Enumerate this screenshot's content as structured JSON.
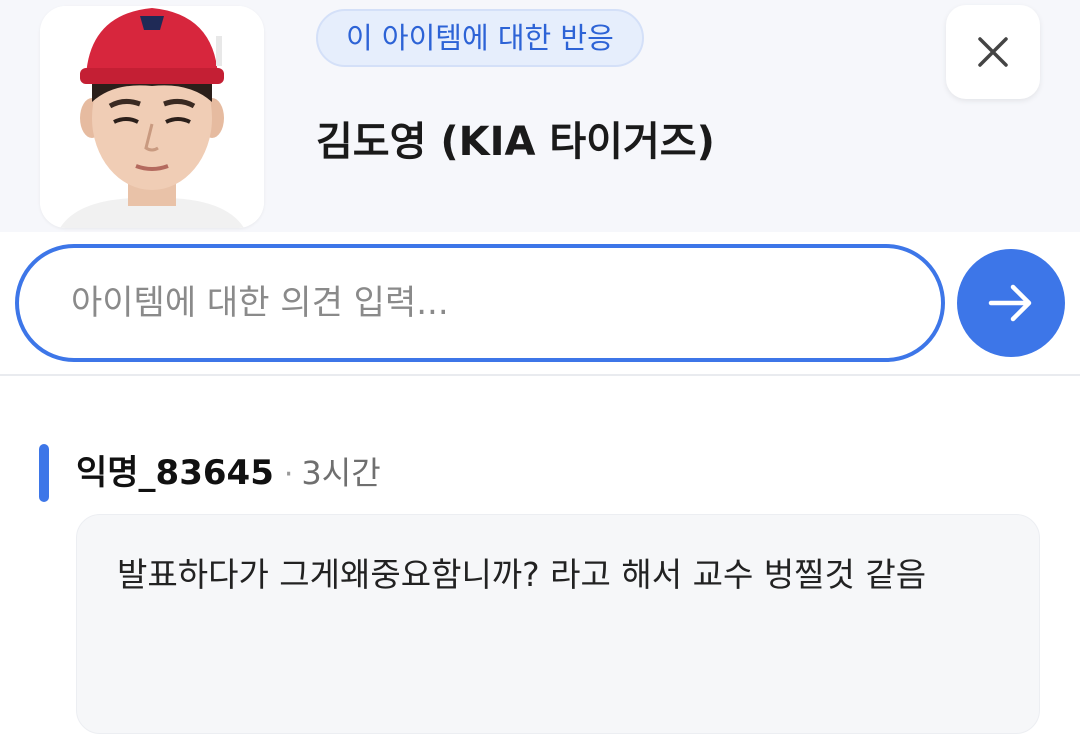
{
  "header": {
    "chip_label": "이 아이템에 대한 반응",
    "item_title": "김도영 (KIA 타이거즈)",
    "close_icon": "close-icon",
    "avatar": "player-photo"
  },
  "composer": {
    "placeholder": "아이템에 대한 의견 입력...",
    "send_icon": "arrow-right-icon"
  },
  "comments": [
    {
      "author": "익명_83645",
      "separator": "·",
      "time": "3시간",
      "text": "발표하다가 그게왜중요함니까? 라고 해서 교수 벙찔것 같음"
    }
  ],
  "colors": {
    "accent": "#3d76e8",
    "chip_bg": "#e6eefc",
    "chip_text": "#2d63d6",
    "header_bg": "#f6f7fb",
    "cap_red": "#d7263d"
  }
}
